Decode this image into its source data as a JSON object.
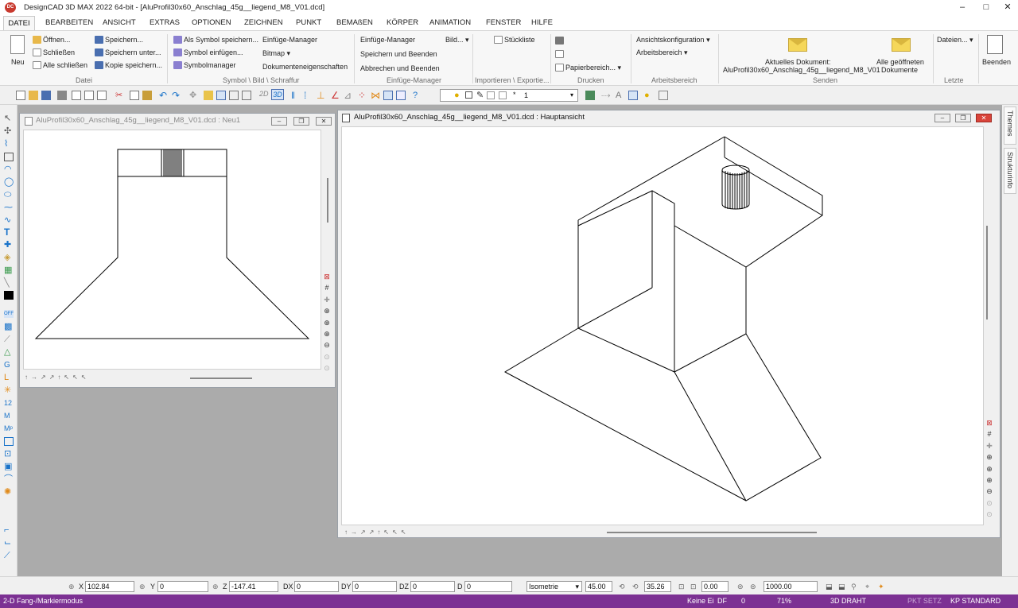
{
  "window": {
    "title": "DesignCAD 3D MAX 2022 64-bit - [AluProfil30x60_Anschlag_45g__liegend_M8_V01.dcd]",
    "app_icon": "DC",
    "minimize": "–",
    "maximize": "□",
    "close": "✕"
  },
  "menu": [
    "DATEI",
    "BEARBEITEN",
    "ANSICHT",
    "EXTRAS",
    "OPTIONEN",
    "ZEICHNEN",
    "PUNKT",
    "BEMAßEN",
    "KÖRPER",
    "ANIMATION",
    "FENSTER",
    "HILFE"
  ],
  "ribbon": {
    "neu": "Neu",
    "oeffnen": "Öffnen...",
    "schliessen": "Schließen",
    "alle_schliessen": "Alle schließen",
    "speichern": "Speichern...",
    "speichern_unter": "Speichern unter...",
    "kopie_speichern": "Kopie speichern...",
    "datei_group": "Datei",
    "als_symbol": "Als Symbol speichern...",
    "symbol_einfuegen": "Symbol einfügen...",
    "symbolmanager": "Symbolmanager",
    "einfuege_manager_1": "Einfüge-Manager",
    "bitmap": "Bitmap",
    "dokumenteigenschaften": "Dokumenteneigenschaften",
    "symbol_group": "Symbol \\ Bild \\ Schraffur",
    "einfuege_manager_2": "Einfüge-Manager",
    "speichern_beenden": "Speichern und Beenden",
    "abbrechen_beenden": "Abbrechen und Beenden",
    "einfuege_group": "Einfüge-Manager",
    "bild": "Bild...",
    "stueckliste": "Stückliste",
    "import_group": "Importieren \\ Exportie...",
    "papierbereich": "Papierbereich...",
    "drucken_group": "Drucken",
    "ansichtskonfiguration": "Ansichtskonfiguration",
    "arbeitsbereich": "Arbeitsbereich",
    "arbeitsbereich_group": "Arbeitsbereich",
    "aktuelles_dokument": "Aktuelles Dokument:",
    "aktuelles_dokument_name": "AluProfil30x60_Anschlag_45g__liegend_M8_V01",
    "alle_geoeffneten_1": "Alle geöffneten",
    "alle_geoeffneten_2": "Dokumente",
    "senden_group": "Senden",
    "dateien": "Dateien...",
    "letzte_group": "Letzte",
    "beenden": "Beenden"
  },
  "toolbar": {
    "btn_2d": "2D",
    "btn_3d": "3D",
    "layer_value": "1"
  },
  "left_window": {
    "title": "AluProfil30x60_Anschlag_45g__liegend_M8_V01.dcd : Neu1"
  },
  "main_window": {
    "title": "AluProfil30x60_Anschlag_45g__liegend_M8_V01.dcd : Hauptansicht"
  },
  "side_tabs": [
    "Themes",
    "Strukturinfo"
  ],
  "coords": {
    "x_label": "X",
    "x": "102.84",
    "y_label": "Y",
    "y": "0",
    "z_label": "Z",
    "z": "-147.41",
    "dx_label": "DX",
    "dx": "0",
    "dy_label": "DY",
    "dy": "0",
    "dz_label": "DZ",
    "dz": "0",
    "d_label": "D",
    "d": "0",
    "view": "Isometrie",
    "angle1": "45.00",
    "angle2": "35.26",
    "angle3": "0.00",
    "scale": "1000.00"
  },
  "status": {
    "mode": "2-D Fang-/Markiermodus",
    "keine": "Keine Ei",
    "df": "DF",
    "zero": "0",
    "zoom": "71%",
    "draht": "3D DRAHT",
    "pkt": "PKT SETZ",
    "kp": "KP STANDARD"
  },
  "colors": {
    "status_bg": "#7c3193",
    "accent_blue": "#1a73c9",
    "mdi_bg": "#ababab"
  }
}
